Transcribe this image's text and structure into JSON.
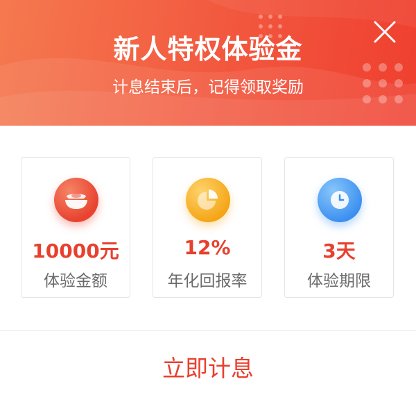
{
  "header": {
    "title": "新人特权体验金",
    "subtitle": "计息结束后，记得领取奖励",
    "close_icon": "close-icon"
  },
  "cards": [
    {
      "icon": "gold-ingot-icon",
      "value": "10000元",
      "label": "体验金额",
      "color_from": "#f16a4f",
      "color_to": "#e43e2b"
    },
    {
      "icon": "pie-chart-icon",
      "value": "12%",
      "label": "年化回报率",
      "color_from": "#fcc54a",
      "color_to": "#f5a313"
    },
    {
      "icon": "clock-icon",
      "value": "3天",
      "label": "体验期限",
      "color_from": "#6cb8f7",
      "color_to": "#3a8ef0"
    }
  ],
  "action": {
    "label": "立即计息"
  },
  "colors": {
    "accent": "#e8402e",
    "header_start": "#f5794f",
    "header_end": "#ef3f2f"
  }
}
